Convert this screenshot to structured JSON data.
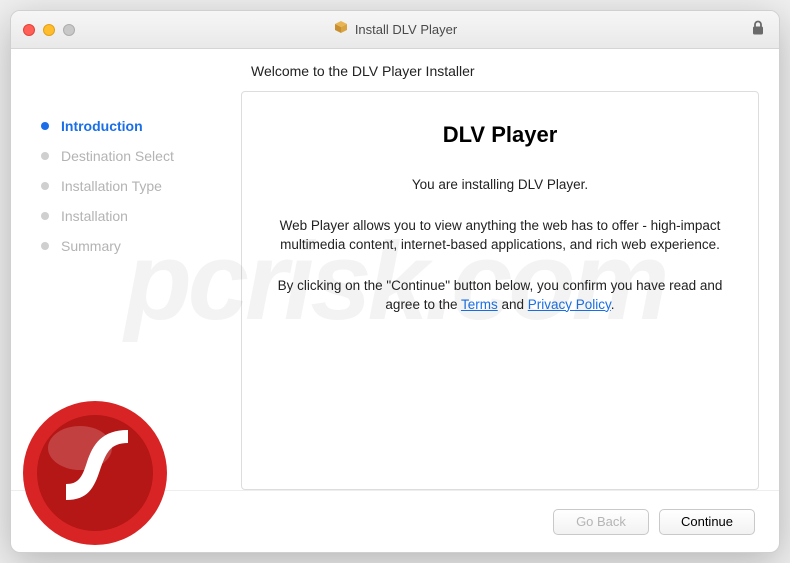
{
  "window": {
    "title": "Install DLV Player"
  },
  "heading": "Welcome to the DLV Player Installer",
  "sidebar": {
    "items": [
      {
        "label": "Introduction",
        "active": true
      },
      {
        "label": "Destination Select",
        "active": false
      },
      {
        "label": "Installation Type",
        "active": false
      },
      {
        "label": "Installation",
        "active": false
      },
      {
        "label": "Summary",
        "active": false
      }
    ]
  },
  "content": {
    "title": "DLV Player",
    "line1": "You are installing DLV Player.",
    "line2": "Web Player allows you to view anything the web has to offer - high-impact multimedia content, internet-based applications, and rich web experience.",
    "agree_prefix": "By clicking on the \"Continue\" button below, you confirm you have read and agree to the ",
    "terms_label": "Terms",
    "agree_mid": " and ",
    "privacy_label": "Privacy Policy",
    "agree_suffix": "."
  },
  "footer": {
    "back_label": "Go Back",
    "continue_label": "Continue"
  },
  "icons": {
    "package": "package-icon",
    "lock": "lock-icon",
    "flash": "flash-player-icon"
  }
}
